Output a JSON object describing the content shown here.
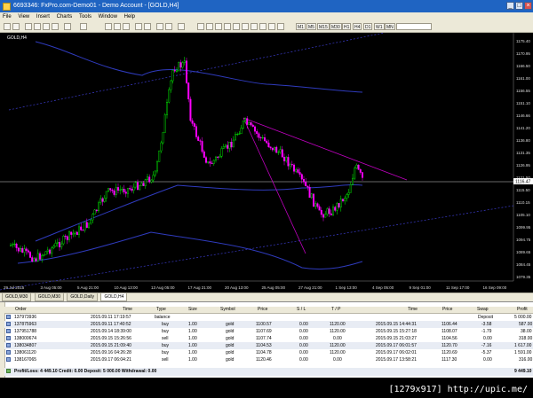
{
  "window": {
    "title": "6693346: FxPro.com-Demo01 - Demo Account - [GOLD,H4]"
  },
  "menu": [
    "File",
    "View",
    "Insert",
    "Charts",
    "Tools",
    "Window",
    "Help"
  ],
  "timeframes": [
    "M1",
    "M5",
    "M15",
    "M30",
    "H1",
    "H4",
    "D1",
    "W1",
    "MN"
  ],
  "active_timeframe": "H4",
  "chart": {
    "symbol_label": "GOLD,H4",
    "price_axis": [
      "1175.40",
      "1170.95",
      "1166.50",
      "1161.00",
      "1156.55",
      "1151.10",
      "1146.66",
      "1141.20",
      "1136.80",
      "1131.35",
      "1126.95",
      "1121.50",
      "1115.50",
      "1110.15",
      "1105.10",
      "1099.95",
      "1094.75",
      "1089.65",
      "1084.45",
      "1079.35"
    ],
    "current_price": "1116.47",
    "time_axis": [
      "29 Jul 2015",
      "3 Aug 05:00",
      "5 Aug 21:00",
      "10 Aug 13:00",
      "13 Aug 05:00",
      "17 Aug 21:00",
      "20 Aug 13:00",
      "25 Aug 05:00",
      "27 Aug 21:00",
      "1 Sep 13:00",
      "4 Sep 05:00",
      "9 Sep 01:00",
      "11 Sep 17:00",
      "16 Sep 09:00"
    ]
  },
  "chart_tabs": [
    "GOLD,M30",
    "GOLD,M30",
    "GOLD,Daily",
    "GOLD,H4"
  ],
  "active_chart_tab": 3,
  "terminal": {
    "columns": {
      "order": "Order",
      "time": "Time",
      "type": "Type",
      "size": "Size",
      "symbol": "Symbol",
      "price": "Price",
      "sl": "S / L",
      "tp": "T / P",
      "close_time": "Time",
      "close_price": "Price",
      "swap": "Swap",
      "profit": "Profit"
    },
    "rows": [
      {
        "order": "137973936",
        "time": "2015.09.11 17:19:57",
        "type": "balance",
        "size": "",
        "symbol": "",
        "price": "",
        "sl": "",
        "tp": "",
        "close_time": "",
        "close_price": "",
        "swap": "Deposit",
        "profit": "5 000.00"
      },
      {
        "order": "137875963",
        "time": "2015.09.11 17:40:52",
        "type": "buy",
        "size": "1.00",
        "symbol": "gold",
        "price": "1100.57",
        "sl": "0.00",
        "tp": "1120.00",
        "close_time": "2015.09.15 14:44:31",
        "close_price": "1106.44",
        "swap": "-3.58",
        "profit": "587.00"
      },
      {
        "order": "137951788",
        "time": "2015.09.14 18:39:00",
        "type": "buy",
        "size": "1.00",
        "symbol": "gold",
        "price": "1107.69",
        "sl": "0.00",
        "tp": "1120.00",
        "close_time": "2015.09.15 15:27:18",
        "close_price": "1108.07",
        "swap": "-1.79",
        "profit": "38.00"
      },
      {
        "order": "138000674",
        "time": "2015.09.15 15:26:56",
        "type": "sell",
        "size": "1.00",
        "symbol": "gold",
        "price": "1107.74",
        "sl": "0.00",
        "tp": "0.00",
        "close_time": "2015.09.15 21:03:27",
        "close_price": "1104.56",
        "swap": "0.00",
        "profit": "318.00"
      },
      {
        "order": "138034807",
        "time": "2015.09.15 21:09:40",
        "type": "buy",
        "size": "1.00",
        "symbol": "gold",
        "price": "1104.53",
        "sl": "0.00",
        "tp": "1120.00",
        "close_time": "2015.09.17 06:01:57",
        "close_price": "1120.70",
        "swap": "-7.16",
        "profit": "1 617.00"
      },
      {
        "order": "138061120",
        "time": "2015.09.16 04:26:28",
        "type": "buy",
        "size": "1.00",
        "symbol": "gold",
        "price": "1104.78",
        "sl": "0.00",
        "tp": "1120.00",
        "close_time": "2015.09.17 06:02:01",
        "close_price": "1120.69",
        "swap": "-5.37",
        "profit": "1 591.00"
      },
      {
        "order": "138167065",
        "time": "2015.09.17 06:04:21",
        "type": "sell",
        "size": "1.00",
        "symbol": "gold",
        "price": "1120.46",
        "sl": "0.00",
        "tp": "0.00",
        "close_time": "2015.09.17 13:58:21",
        "close_price": "1117.30",
        "swap": "0.00",
        "profit": "316.00"
      }
    ],
    "totals": {
      "summary": "Profit/Loss: 4 449.10  Credit: 0.00  Deposit: 5 000.00  Withdrawal: 0.00",
      "total": "9 449.10"
    }
  },
  "watermark": "[1279x917] http://upic.me/",
  "colors": {
    "bull": "#00ff00",
    "bear": "#ff00ff",
    "channel": "#3a3ac8",
    "trend": "#c000c0",
    "titlebar": "#1f64c2"
  }
}
